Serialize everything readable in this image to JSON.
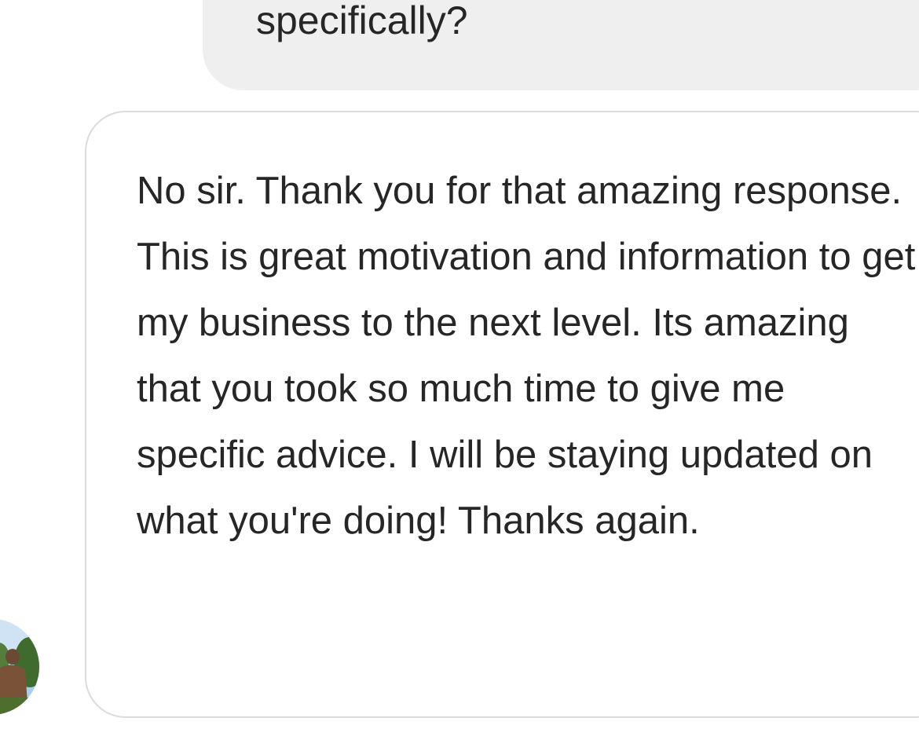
{
  "conversation": {
    "messages": [
      {
        "direction": "sent",
        "text": "specifically?"
      },
      {
        "direction": "received",
        "text": "No sir. Thank you for that amazing response. This is great motivation and information to get my business to the next level. Its amazing that you took so much time to give me specific advice. I will be staying updated on what you're doing! Thanks again."
      }
    ],
    "avatar_icon": "user-photo-avatar"
  },
  "colors": {
    "sent_bubble": "#efefef",
    "received_border": "#dbdbdb",
    "text": "#262626"
  }
}
